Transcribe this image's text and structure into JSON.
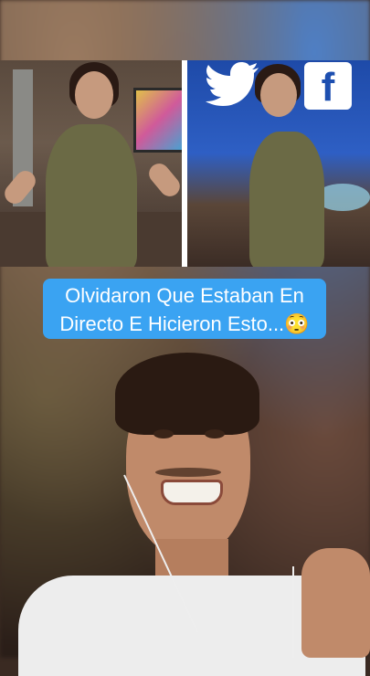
{
  "caption": "Olvidaron Que Estaban En Directo E Hicieron Esto...😳",
  "icons": {
    "twitter": "twitter-logo-icon",
    "facebook": "facebook-logo-icon",
    "facebook_glyph": "f"
  }
}
